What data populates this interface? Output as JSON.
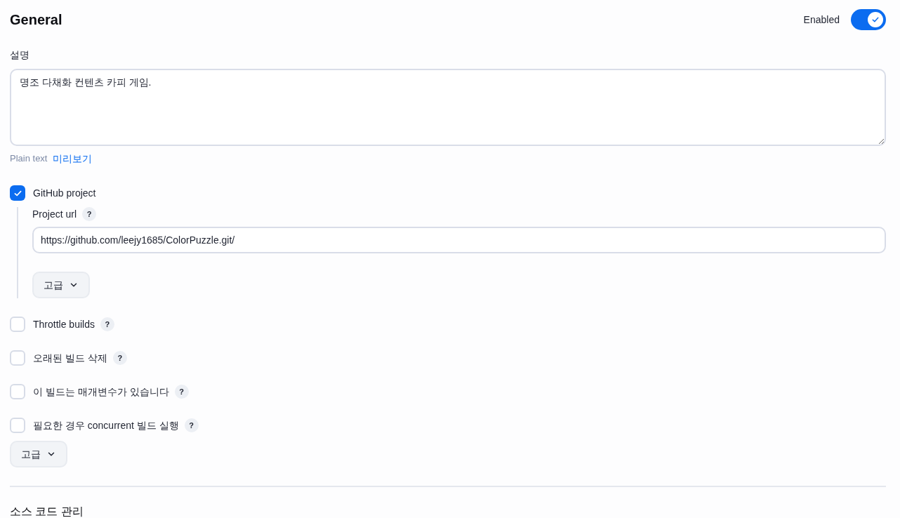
{
  "section": {
    "title": "General",
    "enabled_toggle": {
      "label": "Enabled",
      "on": true
    }
  },
  "description": {
    "label": "설명",
    "value": "명조 다채화 컨텐츠 카피 게임.",
    "format_links": [
      {
        "label": "Plain text",
        "kind": "note"
      },
      {
        "label": "미리보기",
        "kind": "link"
      }
    ]
  },
  "options": [
    {
      "label": "GitHub project",
      "checked": true,
      "fields": [
        {
          "label": "Project url",
          "help": "?",
          "value": "https://github.com/leejy1685/ColorPuzzle.git/"
        }
      ],
      "advanced_button": "고급"
    },
    {
      "label": "Throttle builds",
      "checked": false,
      "help": "?"
    },
    {
      "label": "오래된 빌드 삭제",
      "checked": false,
      "help": "?"
    },
    {
      "label": "이 빌드는 매개변수가 있습니다",
      "checked": false,
      "help": "?"
    },
    {
      "label": "필요한 경우 concurrent 빌드 실행",
      "checked": false,
      "help": "?"
    }
  ],
  "advanced_button": "고급",
  "next_section": {
    "title": "소스 코드 관리"
  }
}
